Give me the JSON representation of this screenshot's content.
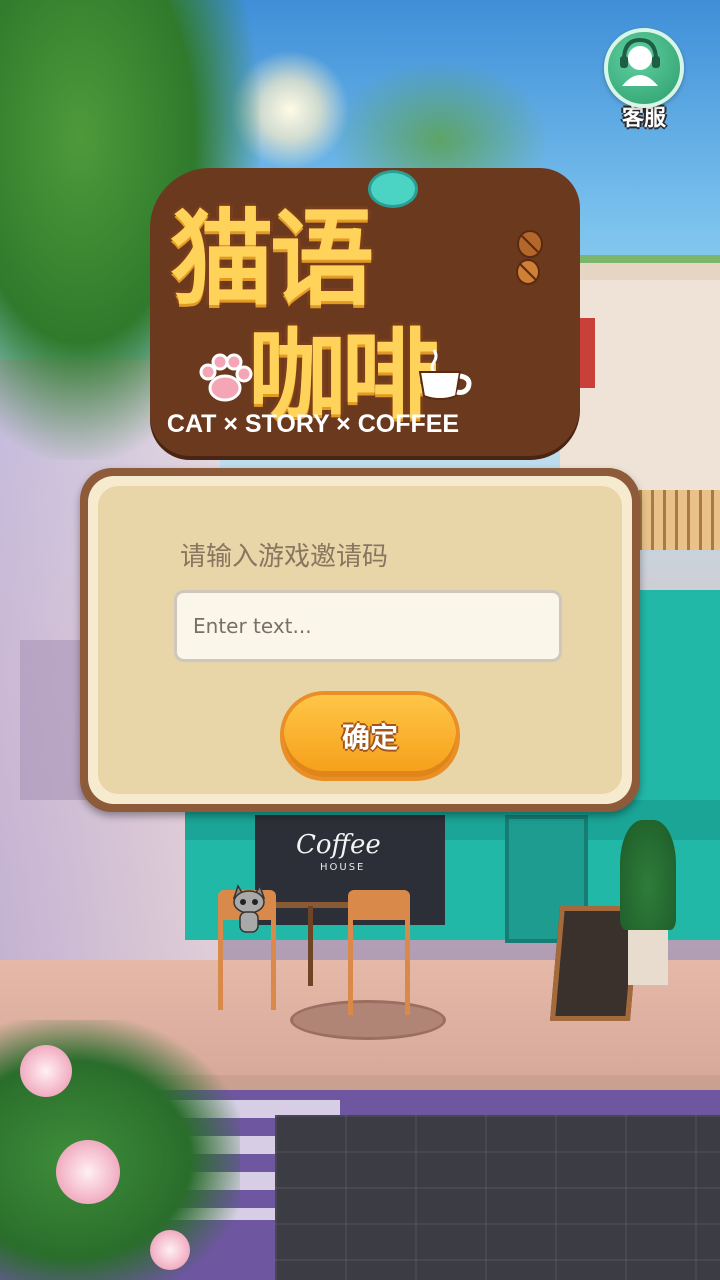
{
  "support": {
    "label": "客服",
    "icon": "headset-agent-icon"
  },
  "logo": {
    "line1": "猫语",
    "line2": "咖啡",
    "subtitle": "CAT × STORY × COFFEE"
  },
  "background": {
    "shop_sign": "Coffee",
    "shop_sign_sub": "HOUSE"
  },
  "invite_dialog": {
    "prompt": "请输入游戏邀请码",
    "input_value": "",
    "input_placeholder": "Enter text...",
    "confirm_label": "确定"
  },
  "colors": {
    "dialog_border": "#8d5a3a",
    "dialog_panel": "#e8d6a9",
    "button_orange": "#f59e18",
    "support_green": "#2e9d6e"
  }
}
